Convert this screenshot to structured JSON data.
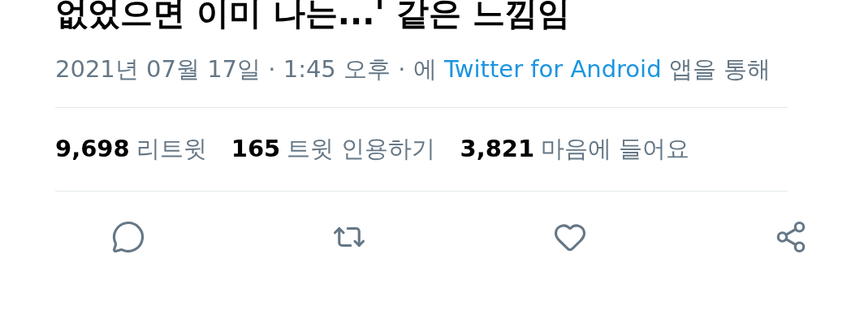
{
  "tweet_text": "없었으면 이미 나는...' 같은 느낌임",
  "meta": {
    "date": "2021년 07월 17일 · 1:45 오후 · 에",
    "source": "Twitter for Android",
    "suffix": "앱을 통해"
  },
  "stats": [
    {
      "count": "9,698",
      "label": "리트윗"
    },
    {
      "count": "165",
      "label": "트윗 인용하기"
    },
    {
      "count": "3,821",
      "label": "마음에 들어요"
    }
  ],
  "actions": [
    {
      "kind": "reply"
    },
    {
      "kind": "retweet"
    },
    {
      "kind": "like"
    },
    {
      "kind": "share"
    }
  ]
}
